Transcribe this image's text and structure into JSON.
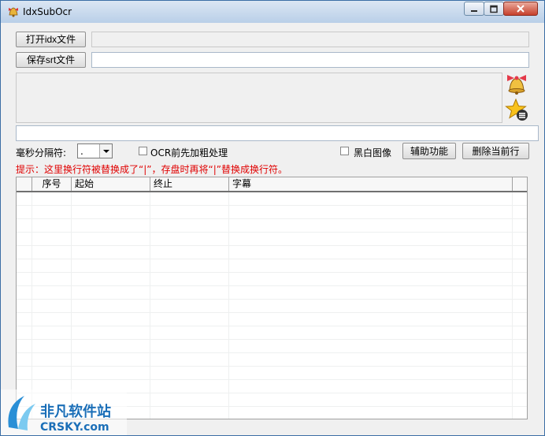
{
  "window": {
    "title": "IdxSubOcr",
    "icon": "bell-app-icon",
    "controls": [
      "minimize-icon",
      "maximize-icon",
      "close-icon"
    ]
  },
  "toolbar": {
    "open_idx_label": "打开idx文件",
    "idx_path": "",
    "save_srt_label": "保存srt文件",
    "srt_path": ""
  },
  "side_icons": [
    "bell-icon",
    "star-list-icon"
  ],
  "options": {
    "ms_separator_label": "毫秒分隔符:",
    "ms_separator_value": ".",
    "ocr_bold_label": "OCR前先加粗处理",
    "ocr_bold_checked": false,
    "bw_label": "黑白图像",
    "bw_checked": false,
    "aux_button": "辅助功能",
    "delete_button": "删除当前行"
  },
  "hint": "提示：这里换行符被替换成了“|”，存盘时再将“|”替换成换行符。",
  "table": {
    "columns": [
      "",
      "序号",
      "起始",
      "终止",
      "字幕"
    ],
    "rows": []
  },
  "watermark": {
    "brand": "非凡软件站",
    "domain": "CRSKY.com"
  },
  "colors": {
    "hint_red": "#e00000",
    "title_gradient_top": "#dbe6f3",
    "title_gradient_bottom": "#b9cfe8",
    "close_red": "#c7402c"
  }
}
